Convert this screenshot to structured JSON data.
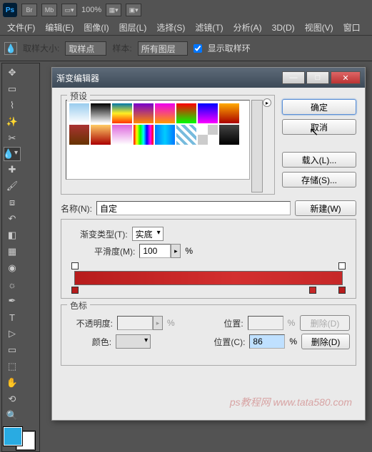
{
  "app": {
    "logo": "Ps",
    "zoom": "100%"
  },
  "top_tags": [
    "Br",
    "Mb"
  ],
  "menus": [
    "文件(F)",
    "编辑(E)",
    "图像(I)",
    "图层(L)",
    "选择(S)",
    "滤镜(T)",
    "分析(A)",
    "3D(D)",
    "视图(V)",
    "窗口"
  ],
  "options": {
    "sample_size_label": "取样大小:",
    "sample_size_value": "取样点",
    "sample_label": "样本:",
    "sample_value": "所有图层",
    "show_ring": "显示取样环"
  },
  "dialog": {
    "title": "渐变编辑器",
    "presets_label": "预设",
    "ok": "确定",
    "cancel": "取消",
    "load": "载入(L)...",
    "save": "存储(S)...",
    "new": "新建(W)",
    "name_label": "名称(N):",
    "name_value": "自定",
    "type_label": "渐变类型(T):",
    "type_value": "实底",
    "smooth_label": "平滑度(M):",
    "smooth_value": "100",
    "percent": "%",
    "stops_label": "色标",
    "opacity_label": "不透明度:",
    "opacity_value": "",
    "pos_label": "位置:",
    "pos_value": "",
    "del1": "删除(D)",
    "color_label": "颜色:",
    "pos2_label": "位置(C):",
    "pos2_value": "86",
    "del2": "删除(D)"
  },
  "preset_gradients": [
    "linear-gradient(#9ce,#fff)",
    "linear-gradient(#000,#fff)",
    "linear-gradient(#07a,#fe2,#f30)",
    "linear-gradient(#70c,#f80)",
    "linear-gradient(#e0e,#f90)",
    "linear-gradient(#f00,#0f0)",
    "linear-gradient(#00f,#f0f)",
    "linear-gradient(#fa0,#a00)",
    "linear-gradient(#a33,#630)",
    "linear-gradient(#fc6,#a00)",
    "linear-gradient(#d6d,#fff)",
    "linear-gradient(90deg,#f00,#ff0,#0f0,#0ff,#00f,#f0f,#f00)",
    "linear-gradient(90deg,#07f,#0cf,#07f)",
    "repeating-linear-gradient(45deg,#7bd,#7bd 4px,#fff 4px,#fff 8px)",
    "repeating-conic-gradient(#ccc 0 25%,#fff 0 50%)",
    "linear-gradient(#444,#000)"
  ],
  "watermark": "ps教程网\nwww.tata580.com"
}
